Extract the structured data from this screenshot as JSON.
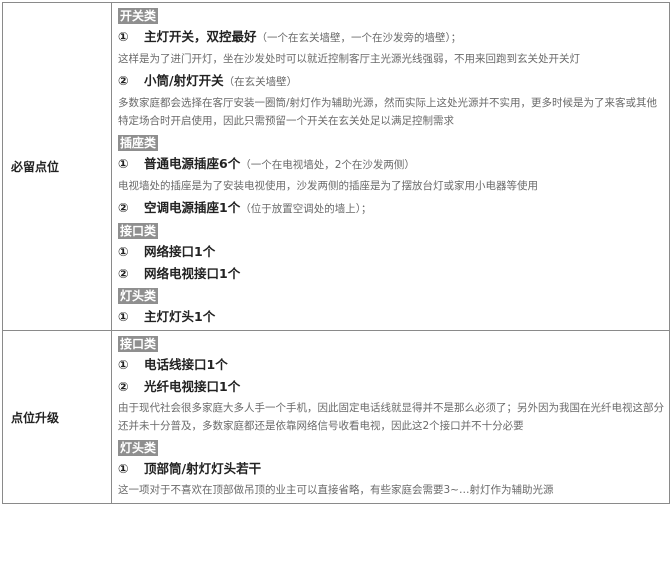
{
  "rows": [
    {
      "header": "必留点位",
      "sections": [
        {
          "category": "开关类",
          "items": [
            {
              "num": "①",
              "name": "主灯开关，双控最好",
              "note": "（一个在玄关墙壁，一个在沙发旁的墙壁）；",
              "desc": "这样是为了进门开灯，坐在沙发处时可以就近控制客厅主光源光线强弱，不用来回跑到玄关处开关灯"
            },
            {
              "num": "②",
              "name": "小筒/射灯开关",
              "note": "（在玄关墙壁）",
              "desc": "多数家庭都会选择在客厅安装一圈筒/射灯作为辅助光源，然而实际上这处光源并不实用，更多时候是为了来客或其他特定场合时开启使用，因此只需预留一个开关在玄关处足以满足控制需求"
            }
          ]
        },
        {
          "category": "插座类",
          "items": [
            {
              "num": "①",
              "name": "普通电源插座6个",
              "note": "（一个在电视墙处，2个在沙发两侧）",
              "desc": "电视墙处的插座是为了安装电视使用，沙发两侧的插座是为了摆放台灯或家用小电器等使用"
            },
            {
              "num": "②",
              "name": "空调电源插座1个",
              "note": "（位于放置空调处的墙上）；",
              "desc": ""
            }
          ]
        },
        {
          "category": "接口类",
          "items": [
            {
              "num": "①",
              "name": "网络接口1个",
              "note": "",
              "desc": ""
            },
            {
              "num": "②",
              "name": "网络电视接口1个",
              "note": "",
              "desc": ""
            }
          ]
        },
        {
          "category": "灯头类",
          "items": [
            {
              "num": "①",
              "name": "主灯灯头1个",
              "note": "",
              "desc": ""
            }
          ]
        }
      ]
    },
    {
      "header": "点位升级",
      "sections": [
        {
          "category": "接口类",
          "items": [
            {
              "num": "①",
              "name": "电话线接口1个",
              "note": "",
              "desc": ""
            },
            {
              "num": "②",
              "name": "光纤电视接口1个",
              "note": "",
              "desc": "由于现代社会很多家庭大多人手一个手机，因此固定电话线就显得并不是那么必须了；另外因为我国在光纤电视这部分还并未十分普及，多数家庭都还是依靠网络信号收看电视，因此这2个接口并不十分必要"
            }
          ]
        },
        {
          "category": "灯头类",
          "items": [
            {
              "num": "①",
              "name": "顶部筒/射灯灯头若干",
              "note": "",
              "desc": "这一项对于不喜欢在顶部做吊顶的业主可以直接省略，有些家庭会需要3~…射灯作为辅助光源"
            }
          ]
        }
      ]
    }
  ]
}
